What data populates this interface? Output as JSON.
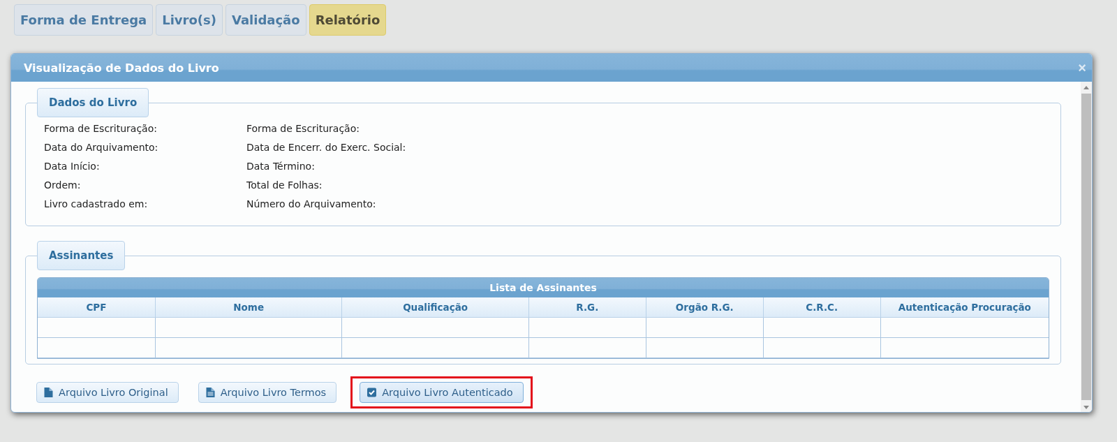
{
  "tabs": [
    {
      "label": "Forma de Entrega",
      "selected": false
    },
    {
      "label": "Livro(s)",
      "selected": false
    },
    {
      "label": "Validação",
      "selected": false
    },
    {
      "label": "Relatório",
      "selected": true
    }
  ],
  "dialog": {
    "title": "Visualização de Dados do Livro",
    "close": "×",
    "book_data": {
      "legend": "Dados do Livro",
      "fields": [
        {
          "label": "Forma de Escrituração:"
        },
        {
          "label": "Forma de Escrituração:"
        },
        {
          "label": "Data do Arquivamento:"
        },
        {
          "label": "Data de Encerr. do Exerc. Social:"
        },
        {
          "label": "Data Início:"
        },
        {
          "label": "Data Término:"
        },
        {
          "label": "Ordem:"
        },
        {
          "label": "Total de Folhas:"
        },
        {
          "label": "Livro cadastrado em:"
        },
        {
          "label": "Número do Arquivamento:"
        }
      ]
    },
    "signers": {
      "legend": "Assinantes",
      "table_title": "Lista de Assinantes",
      "columns": [
        "CPF",
        "Nome",
        "Qualificação",
        "R.G.",
        "Orgão R.G.",
        "C.R.C.",
        "Autenticação Procuração"
      ]
    },
    "buttons": [
      {
        "label": "Arquivo Livro Original",
        "kind": "file",
        "highlighted": false
      },
      {
        "label": "Arquivo Livro Termos",
        "kind": "text-file",
        "highlighted": false
      },
      {
        "label": "Arquivo Livro Autenticado",
        "kind": "check",
        "highlighted": true
      }
    ]
  }
}
